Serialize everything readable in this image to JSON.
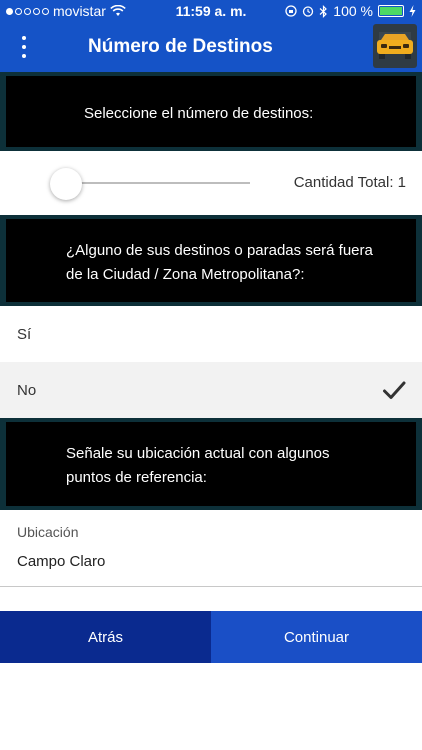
{
  "status_bar": {
    "carrier": "movistar",
    "time": "11:59 a. m.",
    "battery_percent": "100 %"
  },
  "app_bar": {
    "title": "Número de Destinos",
    "menu_icon": "more-vertical-icon",
    "logo_icon": "taxi-icon"
  },
  "destinations": {
    "prompt": "Seleccione el número de destinos:",
    "slider_value": 1,
    "total_label": "Cantidad Total: 1"
  },
  "outside_city": {
    "prompt_line1": "¿Alguno de sus destinos o paradas será fuera",
    "prompt_line2": "de la Ciudad / Zona Metropolitana?:",
    "options": [
      {
        "label": "Sí",
        "selected": false
      },
      {
        "label": "No",
        "selected": true
      }
    ]
  },
  "location": {
    "prompt_line1": "Señale su ubicación actual con algunos",
    "prompt_line2": "puntos de referencia:",
    "field_label": "Ubicación",
    "field_value": "Campo Claro"
  },
  "buttons": {
    "back": "Atrás",
    "continue": "Continuar"
  },
  "colors": {
    "primary": "#1553c7",
    "back_button": "#0a2a8f",
    "continue_button": "#1a4fc6",
    "banner": "#000000"
  }
}
